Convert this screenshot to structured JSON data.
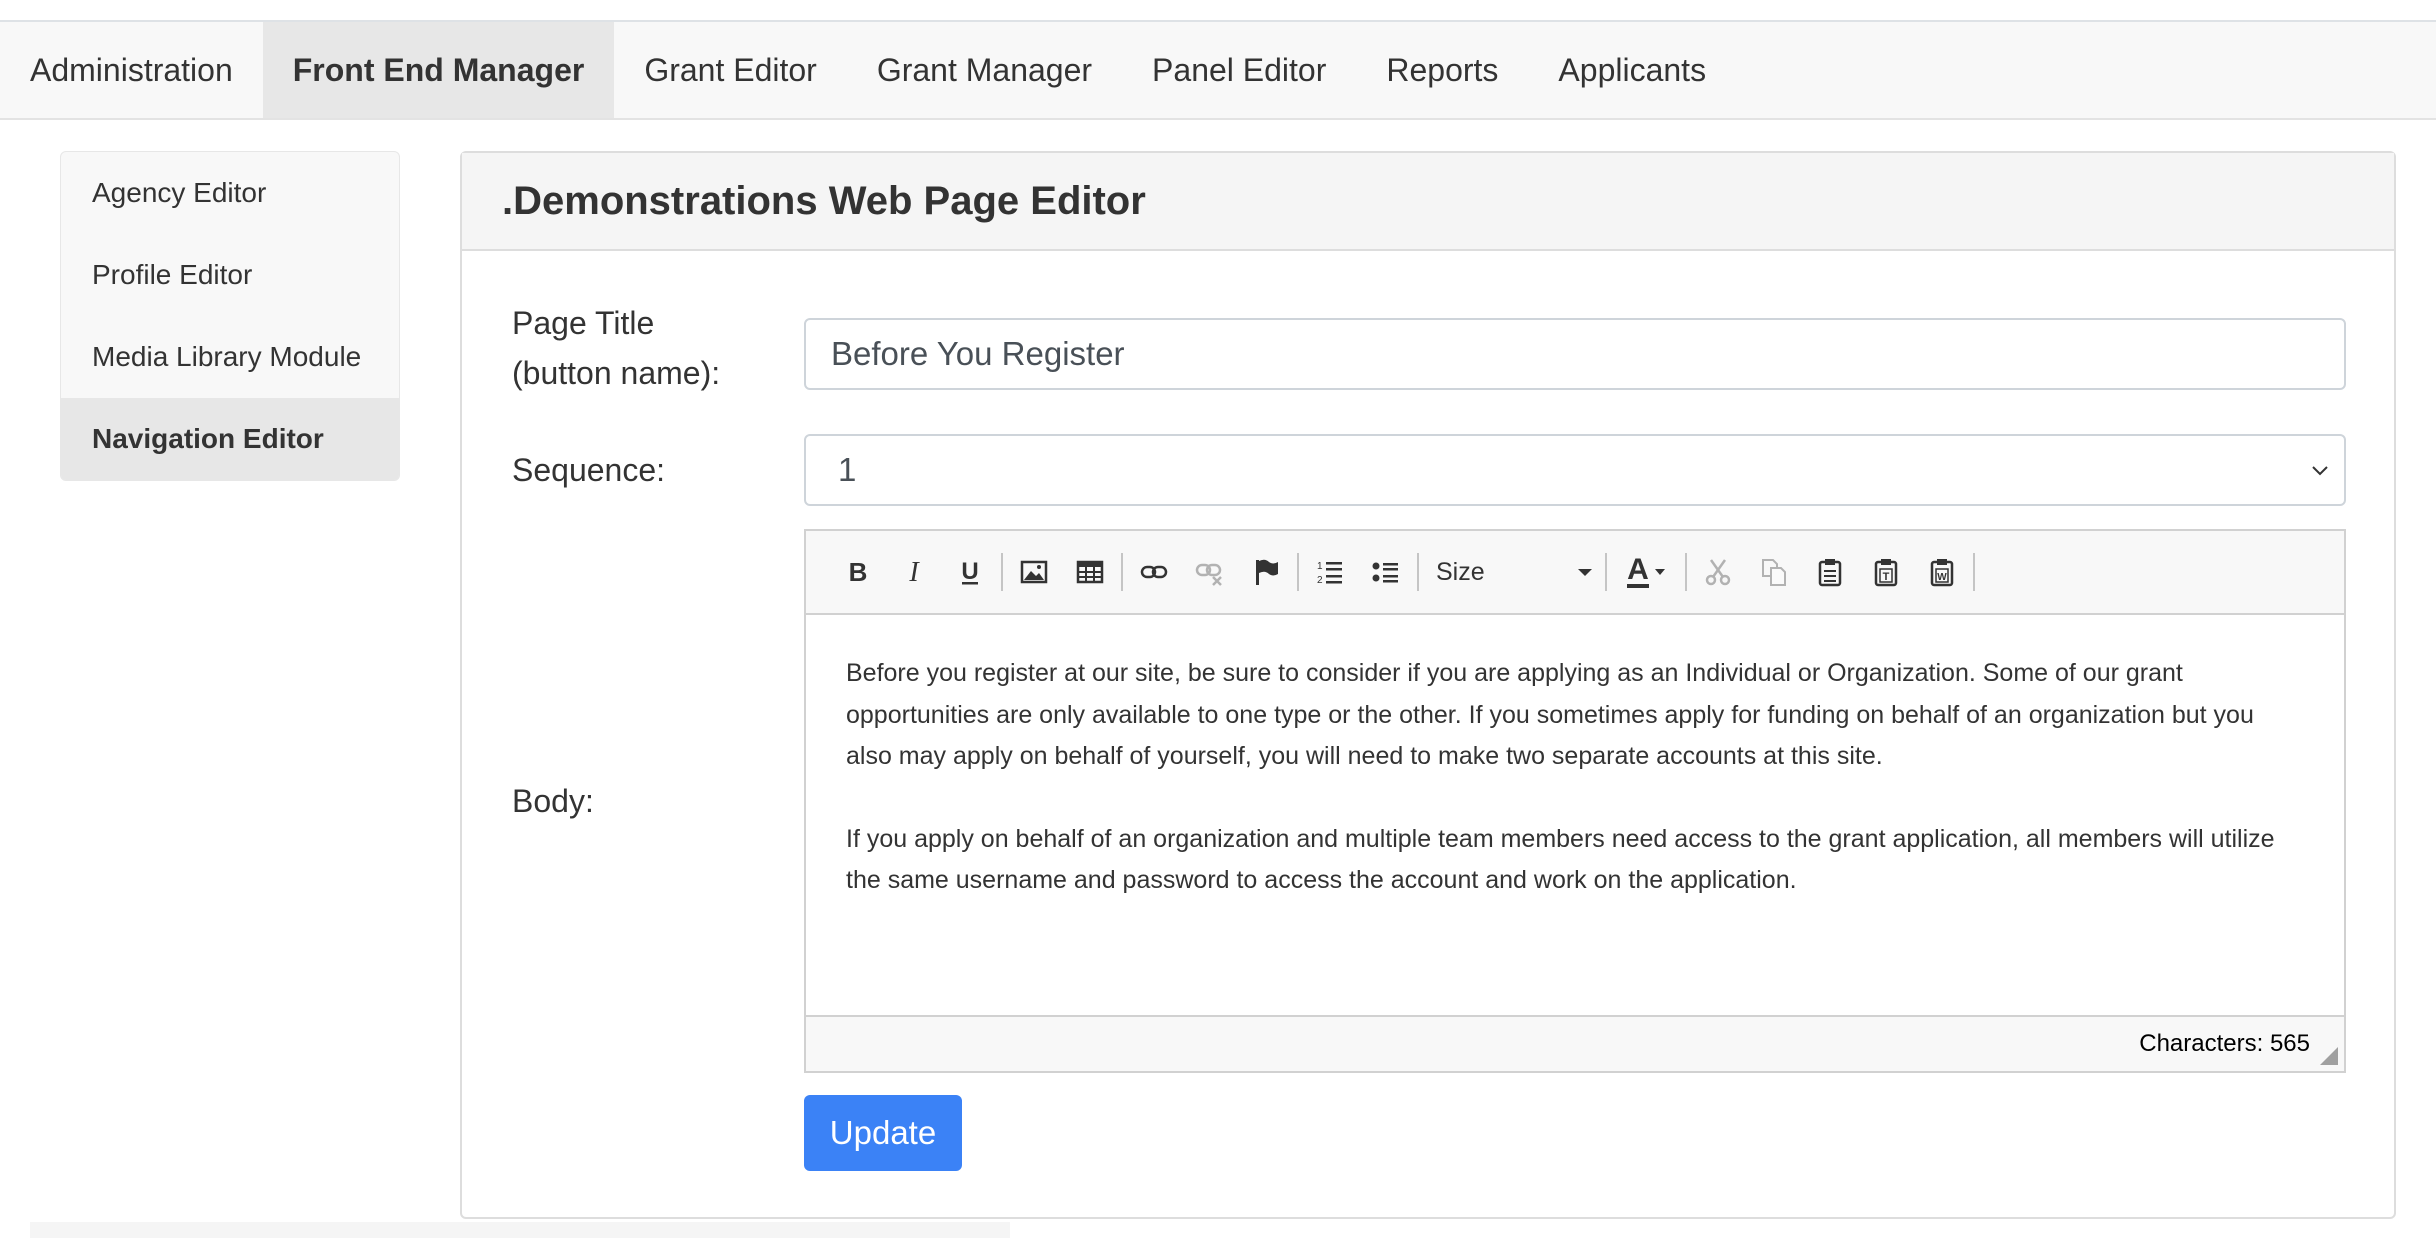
{
  "top_nav": [
    {
      "label": "Administration",
      "active": false
    },
    {
      "label": "Front End Manager",
      "active": true
    },
    {
      "label": "Grant Editor",
      "active": false
    },
    {
      "label": "Grant Manager",
      "active": false
    },
    {
      "label": "Panel Editor",
      "active": false
    },
    {
      "label": "Reports",
      "active": false
    },
    {
      "label": "Applicants",
      "active": false
    }
  ],
  "sidebar": [
    {
      "label": "Agency Editor",
      "active": false
    },
    {
      "label": "Profile Editor",
      "active": false
    },
    {
      "label": "Media Library Module",
      "active": false
    },
    {
      "label": "Navigation Editor",
      "active": true
    }
  ],
  "panel": {
    "title": ".Demonstrations Web Page Editor"
  },
  "form": {
    "page_title_label_line1": "Page Title",
    "page_title_label_line2": "(button name):",
    "page_title_value": "Before You Register",
    "sequence_label": "Sequence:",
    "sequence_value": "1",
    "body_label": "Body:"
  },
  "editor": {
    "toolbar_icons": [
      "bold-icon",
      "italic-icon",
      "underline-icon",
      "image-icon",
      "table-icon",
      "link-icon",
      "unlink-icon",
      "flag-icon",
      "numbered-list-icon",
      "bullet-list-icon",
      "font-color-icon",
      "cut-icon",
      "copy-icon",
      "paste-icon",
      "paste-text-icon",
      "paste-word-icon"
    ],
    "size_label": "Size",
    "font_color_glyph": "A",
    "paragraphs": [
      "Before you register at our site, be sure to consider if you are applying as an Individual or Organization. Some of our grant opportunities are only available to one type or the other. If you sometimes apply for funding on behalf of an organization but you also may apply on behalf of yourself, you will need to make two separate accounts at this site.",
      "If you apply on behalf of an organization and multiple team members need access to the grant application, all members will utilize the same username and password to access the account and work on the application."
    ],
    "char_count": "Characters: 565"
  },
  "update_button_label": "Update",
  "colors": {
    "primary": "#3b82f6",
    "nav_bg": "#f8f8f8",
    "nav_active_bg": "#e7e7e7",
    "text": "#333333"
  }
}
